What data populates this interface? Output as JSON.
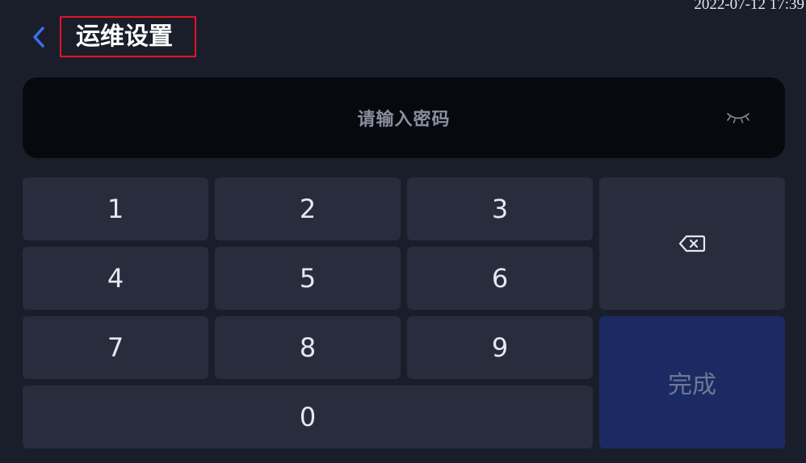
{
  "status": {
    "datetime": "2022-07-12 17:39"
  },
  "header": {
    "back_icon": "chevron-left-icon",
    "title": "运维设置"
  },
  "password": {
    "placeholder": "请输入密码",
    "visibility_icon": "eye-closed-icon"
  },
  "keypad": {
    "keys": [
      "1",
      "2",
      "3",
      "4",
      "5",
      "6",
      "7",
      "8",
      "9",
      "0"
    ],
    "backspace_icon": "backspace-icon",
    "done_label": "完成"
  },
  "colors": {
    "background": "#1a1e2a",
    "key": "#282d3e",
    "done_key": "#1c2a63",
    "accent": "#3a6ff0",
    "highlight_border": "#e0142a"
  }
}
